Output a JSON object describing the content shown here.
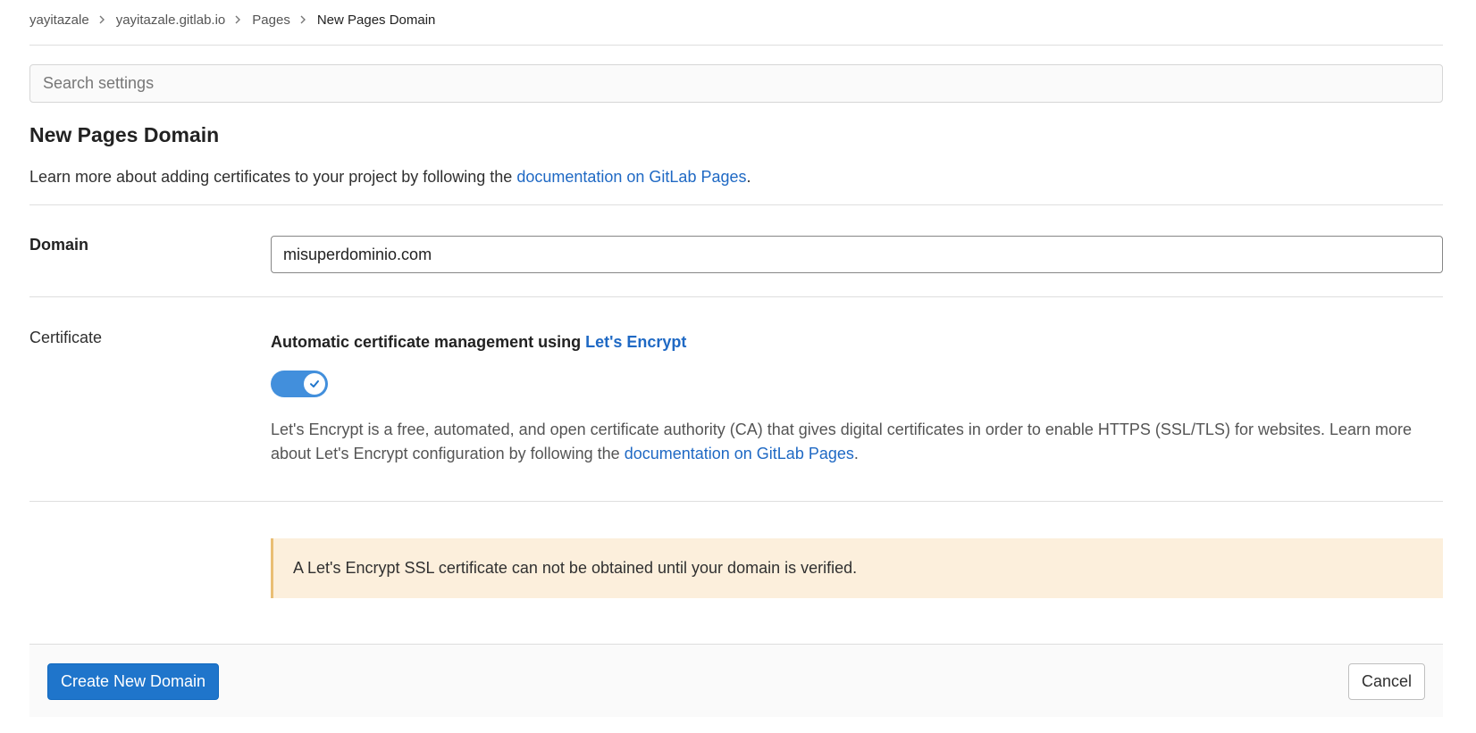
{
  "breadcrumb": {
    "items": [
      "yayitazale",
      "yayitazale.gitlab.io",
      "Pages"
    ],
    "current": "New Pages Domain"
  },
  "search": {
    "placeholder": "Search settings",
    "value": ""
  },
  "page": {
    "title": "New Pages Domain",
    "intro_text": "Learn more about adding certificates to your project by following the ",
    "intro_link": "documentation on GitLab Pages",
    "intro_end": "."
  },
  "domain": {
    "label": "Domain",
    "value": "misuperdominio.com"
  },
  "certificate": {
    "label": "Certificate",
    "heading_text": "Automatic certificate management using ",
    "heading_link": "Let's Encrypt",
    "toggle_enabled": true,
    "description_text": "Let's Encrypt is a free, automated, and open certificate authority (CA) that gives digital certificates in order to enable HTTPS (SSL/TLS) for websites. Learn more about Let's Encrypt configuration by following the ",
    "description_link": "documentation on GitLab Pages",
    "description_end": "."
  },
  "alert": {
    "text": "A Let's Encrypt SSL certificate can not be obtained until your domain is verified."
  },
  "footer": {
    "create_label": "Create New Domain",
    "cancel_label": "Cancel"
  },
  "colors": {
    "primary": "#1f75cb",
    "link": "#1f69c4",
    "toggle": "#428fdc",
    "alert_bg": "#fcefdc",
    "alert_border": "#e9be74"
  }
}
